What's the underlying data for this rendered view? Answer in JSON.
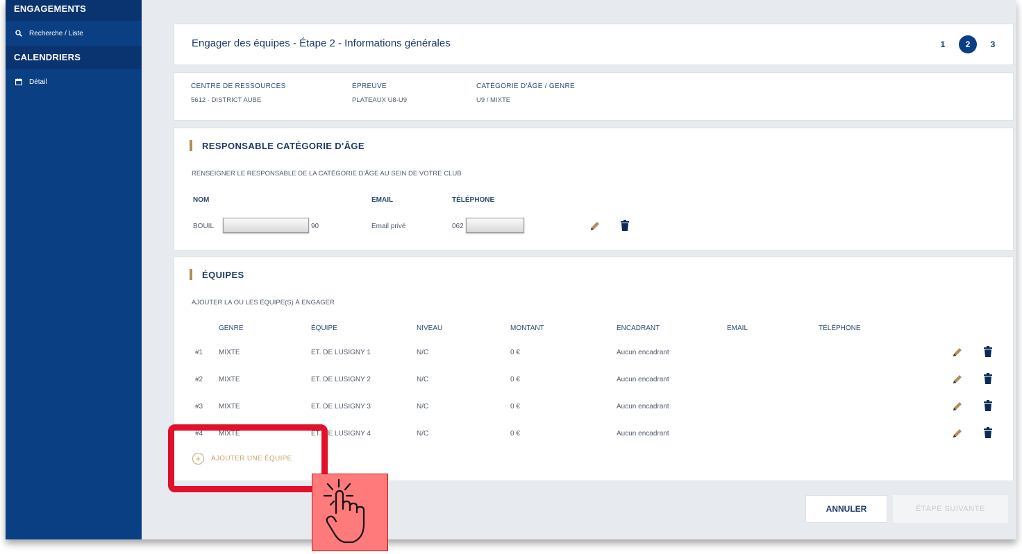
{
  "sidebar": {
    "section1": "ENGAGEMENTS",
    "item1": "Recherche / Liste",
    "section2": "CALENDRIERS",
    "item2": "Détail"
  },
  "header": {
    "title": "Engager des équipes - Étape 2 - Informations générales",
    "steps": [
      "1",
      "2",
      "3"
    ],
    "active_step": "2"
  },
  "info": {
    "centre_label": "CENTRE DE RESSOURCES",
    "centre_value": "5612 - DISTRICT AUBE",
    "epreuve_label": "ÉPREUVE",
    "epreuve_value": "PLATEAUX U8-U9",
    "categorie_label": "CATÉGORIE D'ÂGE / GENRE",
    "categorie_value": "U9 / MIXTE"
  },
  "responsable": {
    "title": "RESPONSABLE CATÉGORIE D'ÂGE",
    "subtitle": "RENSEIGNER LE RESPONSABLE DE LA CATÉGORIE D'ÂGE AU SEIN DE VOTRE CLUB",
    "headers": {
      "nom": "NOM",
      "email": "EMAIL",
      "telephone": "TÉLÉPHONE"
    },
    "nom_start": "BOUIL",
    "nom_end": "90",
    "email": "Email privé",
    "telephone_start": "062"
  },
  "equipes": {
    "title": "ÉQUIPES",
    "subtitle": "AJOUTER LA OU LES ÉQUIPE(S) À ENGAGER",
    "headers": [
      "GENRE",
      "ÉQUIPE",
      "NIVEAU",
      "MONTANT",
      "ENCADRANT",
      "EMAIL",
      "TÉLÉPHONE"
    ],
    "rows": [
      {
        "num": "#1",
        "genre": "MIXTE",
        "equipe": "ET. DE LUSIGNY 1",
        "niveau": "N/C",
        "montant": "0 €",
        "encadrant": "Aucun encadrant"
      },
      {
        "num": "#2",
        "genre": "MIXTE",
        "equipe": "ET. DE LUSIGNY 2",
        "niveau": "N/C",
        "montant": "0 €",
        "encadrant": "Aucun encadrant"
      },
      {
        "num": "#3",
        "genre": "MIXTE",
        "equipe": "ET. DE LUSIGNY 3",
        "niveau": "N/C",
        "montant": "0 €",
        "encadrant": "Aucun encadrant"
      },
      {
        "num": "#4",
        "genre": "MIXTE",
        "equipe": "ET. DE LUSIGNY 4",
        "niveau": "N/C",
        "montant": "0 €",
        "encadrant": "Aucun encadrant"
      }
    ],
    "add_label": "AJOUTER UNE ÉQUIPE"
  },
  "footer": {
    "cancel_label": "ANNULER",
    "next_label": "ÉTAPE SUIVANTE"
  },
  "colors": {
    "sidebar": "#0b3f84",
    "accent_gold": "#b08d5a",
    "highlight_red": "#e2102a"
  },
  "icons": [
    "search-icon",
    "calendar-icon",
    "pencil-icon",
    "trash-icon",
    "plus-circle-icon",
    "tap-hand-icon"
  ]
}
